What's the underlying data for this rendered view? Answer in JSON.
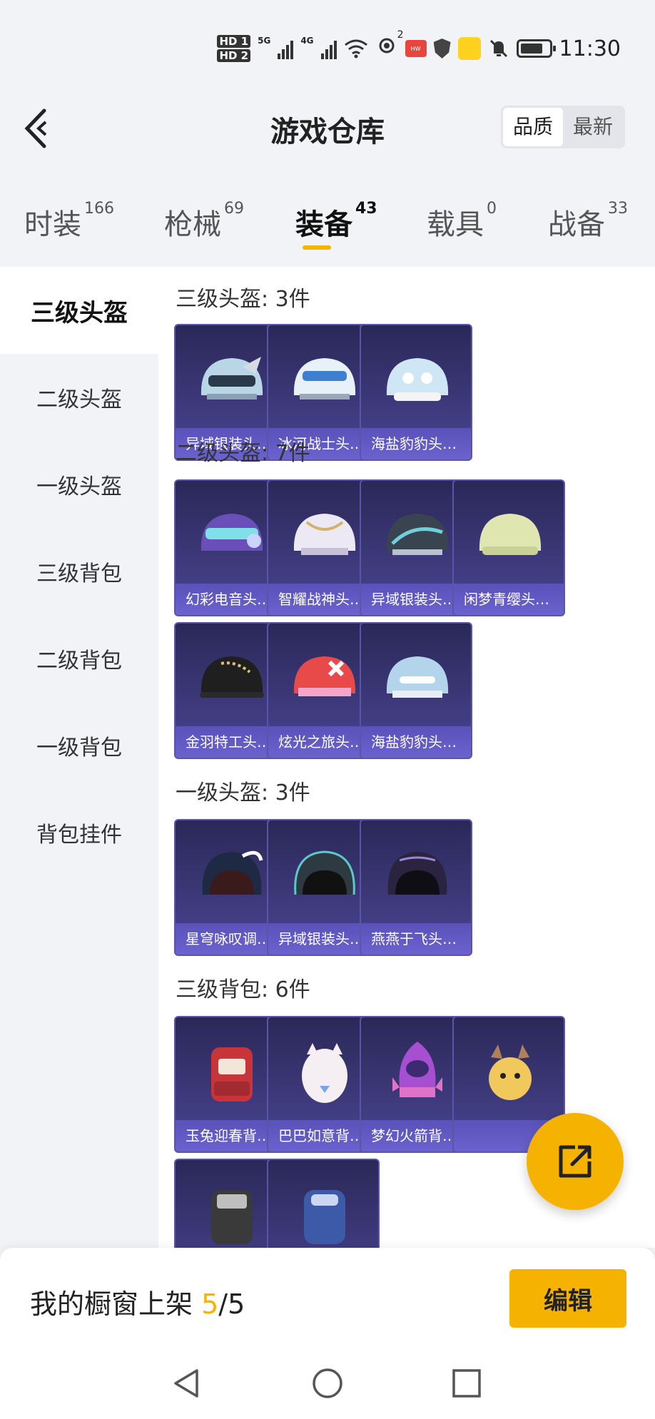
{
  "status_bar": {
    "hd1": "HD 1",
    "hd2": "HD 2",
    "net1": "5G",
    "net2": "4G",
    "hotspot_count": "2",
    "time": "11:30",
    "icons": [
      "hd-icon",
      "signal-icon",
      "wifi-icon",
      "hotspot-icon",
      "huawei-icon",
      "shield-icon",
      "app-icon",
      "mute-icon",
      "battery-icon"
    ]
  },
  "header": {
    "title": "游戏仓库",
    "sort_quality": "品质",
    "sort_latest": "最新"
  },
  "tabs": [
    {
      "label": "时装",
      "count": "166"
    },
    {
      "label": "枪械",
      "count": "69"
    },
    {
      "label": "装备",
      "count": "43",
      "active": true
    },
    {
      "label": "载具",
      "count": "0"
    },
    {
      "label": "战备",
      "count": "33"
    }
  ],
  "sidebar": [
    {
      "label": "三级头盔",
      "active": true
    },
    {
      "label": "二级头盔"
    },
    {
      "label": "一级头盔"
    },
    {
      "label": "三级背包"
    },
    {
      "label": "二级背包"
    },
    {
      "label": "一级背包"
    },
    {
      "label": "背包挂件"
    }
  ],
  "sections": [
    {
      "title": "三级头盔: 3件",
      "items": [
        "异域银装头…",
        "冰河战士头…",
        "海盐豹豹头…"
      ]
    },
    {
      "title": "二级头盔: 7件",
      "items": [
        "幻彩电音头…",
        "智耀战神头…",
        "异域银装头…",
        "闲梦青缨头…",
        "金羽特工头…",
        "炫光之旅头…",
        "海盐豹豹头…"
      ]
    },
    {
      "title": "一级头盔: 3件",
      "items": [
        "星穹咏叹调…",
        "异域银装头…",
        "燕燕于飞头…"
      ]
    },
    {
      "title": "三级背包: 6件",
      "items": [
        "玉兔迎春背…",
        "巴巴如意背…",
        "梦幻火箭背…",
        "",
        "",
        ""
      ]
    }
  ],
  "showcase": {
    "label": "我的橱窗上架",
    "current": "5",
    "total": "/5",
    "edit": "编辑"
  },
  "colors": {
    "accent": "#f6b200",
    "card_bg": "#3c3878",
    "card_label": "#6b62cf"
  }
}
